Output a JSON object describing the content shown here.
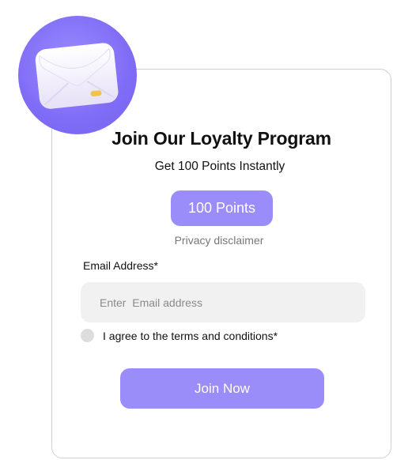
{
  "header": {
    "icon": "envelope-icon",
    "title": "Join Our Loyalty Program",
    "subtitle": "Get 100 Points Instantly"
  },
  "points_badge": {
    "label": "100 Points"
  },
  "privacy": {
    "label": "Privacy disclaimer"
  },
  "form": {
    "email_label": "Email Address*",
    "email_placeholder": "Enter  Email address",
    "email_value": "",
    "terms_label": "I agree to the terms and conditions*",
    "terms_checked": false,
    "submit_label": "Join Now"
  },
  "colors": {
    "accent": "#9a8cf9",
    "badge_circle": "#7f6cf6",
    "input_bg": "#f1f1f1",
    "checkbox": "#dddddd",
    "card_border": "#cfcfcf"
  }
}
